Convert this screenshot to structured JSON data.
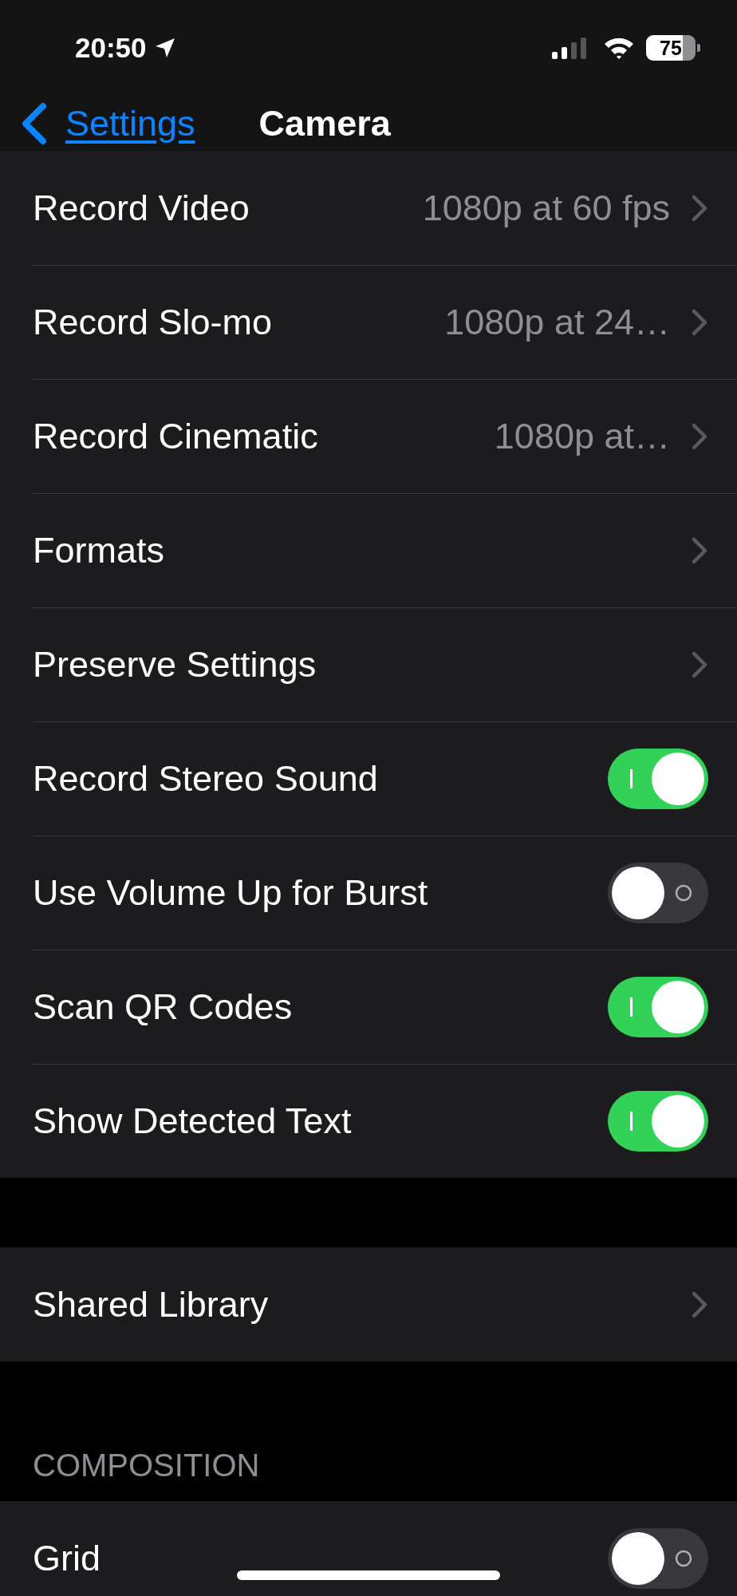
{
  "status_bar": {
    "time": "20:50",
    "battery": "75"
  },
  "nav": {
    "back": "Settings",
    "title": "Camera"
  },
  "groups": [
    {
      "rows": [
        {
          "kind": "link",
          "label": "Record Video",
          "value": "1080p at 60 fps"
        },
        {
          "kind": "link",
          "label": "Record Slo-mo",
          "value": "1080p at 24…"
        },
        {
          "kind": "link",
          "label": "Record Cinematic",
          "value": "1080p at…"
        },
        {
          "kind": "link",
          "label": "Formats"
        },
        {
          "kind": "link",
          "label": "Preserve Settings"
        },
        {
          "kind": "toggle",
          "label": "Record Stereo Sound",
          "on": true
        },
        {
          "kind": "toggle",
          "label": "Use Volume Up for Burst",
          "on": false
        },
        {
          "kind": "toggle",
          "label": "Scan QR Codes",
          "on": true
        },
        {
          "kind": "toggle",
          "label": "Show Detected Text",
          "on": true
        }
      ]
    },
    {
      "rows": [
        {
          "kind": "link",
          "label": "Shared Library"
        }
      ]
    },
    {
      "header": "COMPOSITION",
      "rows": [
        {
          "kind": "toggle",
          "label": "Grid",
          "on": false
        }
      ]
    }
  ]
}
